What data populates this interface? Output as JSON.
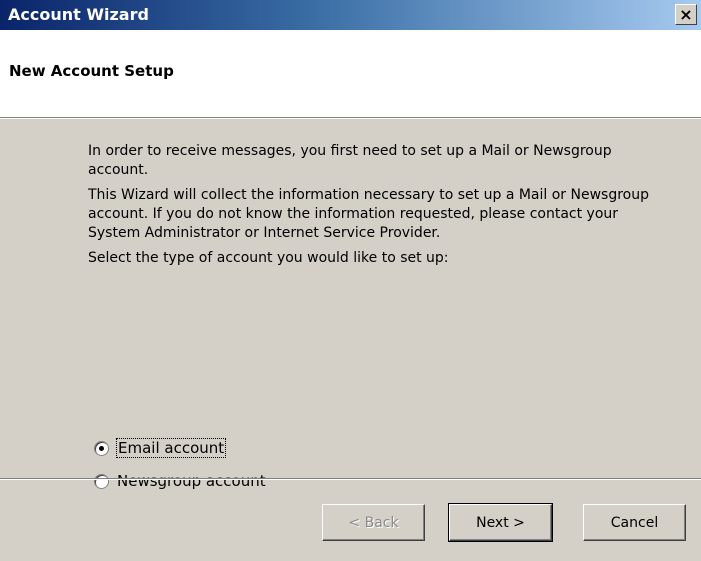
{
  "window": {
    "title": "Account Wizard",
    "close_glyph": "×"
  },
  "header": {
    "title": "New Account Setup"
  },
  "content": {
    "paragraph1": "In order to receive messages, you first need to set up a Mail or Newsgroup account.",
    "paragraph2": "This Wizard will collect the information necessary to set up a Mail or Newsgroup account. If you do not know the information requested, please contact your System Administrator or Internet Service Provider.",
    "prompt": "Select the type of account you would like to set up:"
  },
  "options": [
    {
      "label": "Email account",
      "selected": true
    },
    {
      "label": "Newsgroup account",
      "selected": false
    }
  ],
  "buttons": {
    "back": "< Back",
    "next": "Next >",
    "cancel": "Cancel"
  },
  "colors": {
    "title_bar_start": "#0a246a",
    "title_bar_end": "#a6caf0",
    "dialog_face": "#d4d0c8",
    "header_bg": "#ffffff"
  }
}
